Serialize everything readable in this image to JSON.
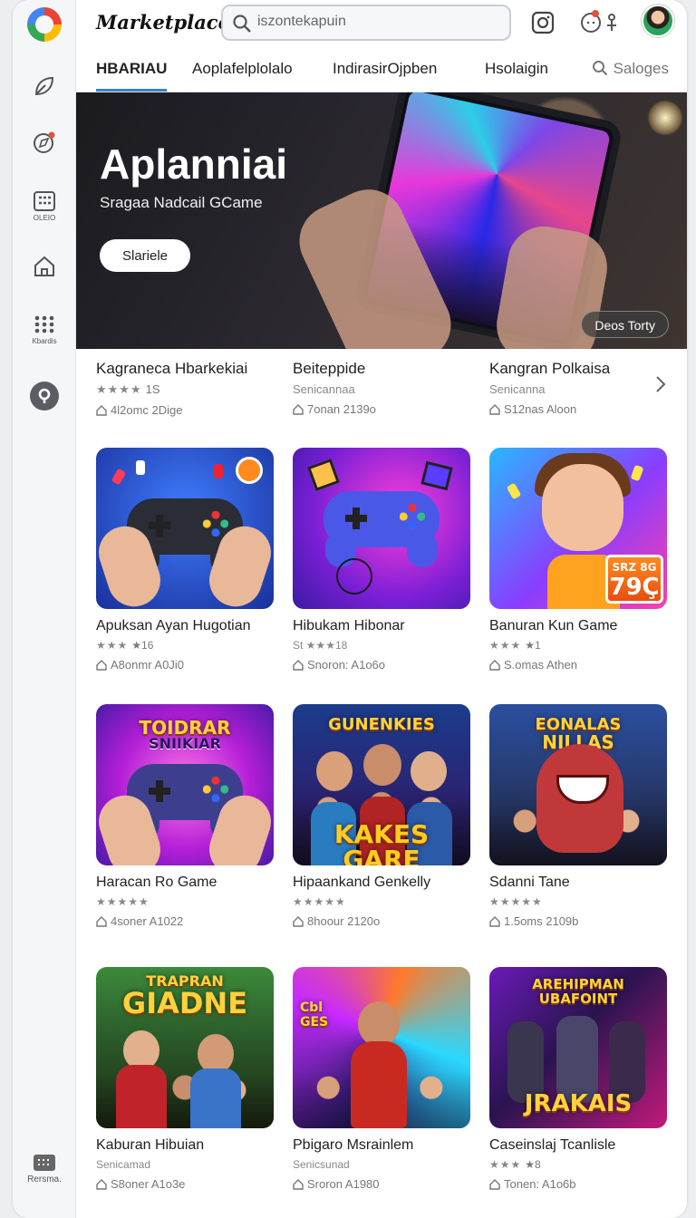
{
  "app": {
    "brand": "Marketplace"
  },
  "search": {
    "value": "iszontekapuin"
  },
  "tabs": [
    {
      "label": "HBARIAU",
      "active": true
    },
    {
      "label": "Aoplafelplolalo"
    },
    {
      "label": "IndirasirOjpben"
    },
    {
      "label": "Hsolaigin"
    }
  ],
  "tab_search_label": "Saloges",
  "sidebar": {
    "bottom_label": "Rersma.",
    "item_labels": [
      "OLEIO",
      "Kbardis"
    ]
  },
  "hero": {
    "title": "Aplanniai",
    "subtitle": "Sragaa Nadcail GCame",
    "button": "Slariele",
    "badge": "Deos Torty"
  },
  "strip": [
    {
      "name": "Kagraneca Hbarkekiai",
      "rating": "★★★★",
      "count": "1S",
      "meta": "4l2omc 2Dige"
    },
    {
      "name": "Beiteppide",
      "sub": "Senicannaa",
      "meta": "7onan 2139o"
    },
    {
      "name": "Kangran Polkaisa",
      "sub": "Senicanna",
      "meta": "S12nas Aloon"
    }
  ],
  "cards": [
    {
      "name": "Apuksan Ayan Hugotian",
      "rating": "★★★",
      "count": "★16",
      "meta": "A8onmr A0Ji0"
    },
    {
      "name": "Hibukam Hibonar",
      "sub": "St ★★★18",
      "meta": "Snoron: A1o6o"
    },
    {
      "name": "Banuran Kun Game",
      "rating": "★★★",
      "count": "★1",
      "meta": "S.omas Athen",
      "price_small": "SRZ 8G",
      "price_big": "79Ç"
    },
    {
      "name": "Haracan Ro Game",
      "rating": "★★★★★",
      "meta": "4soner A1022",
      "art_title_top": "TOIDRAR",
      "art_title_bottom": "SNIIKIAR"
    },
    {
      "name": "Hipaankand Genkelly",
      "rating": "★★★★★",
      "meta": "8hoour 2120o",
      "art_title_top": "GUNENKIES",
      "art_title_bottom": "KAKES GARE"
    },
    {
      "name": "Sdanni Tane",
      "rating": "★★★★★",
      "meta": "1.5oms 2109b",
      "art_title_top": "EONALAS",
      "art_title_bottom": "NILLAS"
    },
    {
      "name": "Kaburan Hibuian",
      "sub": "Senicamad",
      "meta": "S8oner A1o3e",
      "art_title_top": "TRAPRAN",
      "art_title_bottom": "GIADNE"
    },
    {
      "name": "Pbigaro Msrainlem",
      "sub": "Senicsunad",
      "meta": "Sroron A1980",
      "art_title_top": "Cbl",
      "art_title_bottom": "GES"
    },
    {
      "name": "Caseinslaj Tcanlisle",
      "rating": "★★★",
      "count": "★8",
      "meta": "Tonen: A1o6b",
      "art_title_top": "AREHIPMAN",
      "art_title_bottom": "UBAFOINT",
      "art_title_low": "JRAKAIS"
    }
  ]
}
